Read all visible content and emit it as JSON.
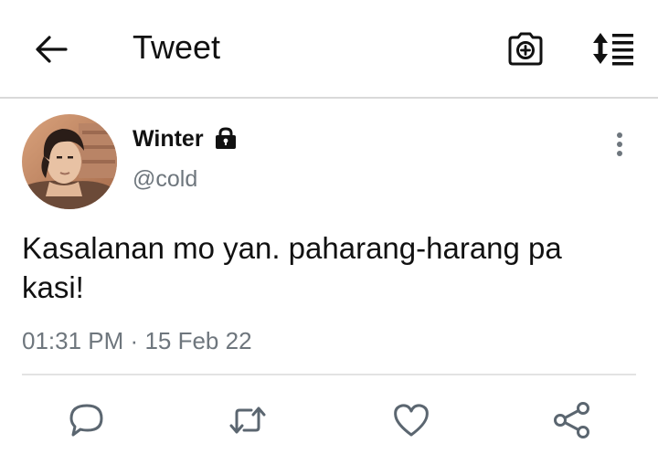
{
  "header": {
    "title": "Tweet",
    "back_icon": "arrow-left-icon",
    "camera_icon": "camera-plus-icon",
    "sort_icon": "sort-list-icon"
  },
  "tweet": {
    "author": {
      "display_name": "Winter",
      "handle": "@cold",
      "protected_icon": "lock-icon",
      "avatar": "profile-photo"
    },
    "text": "Kasalanan mo yan. paharang-harang pa kasi!",
    "time": "01:31 PM",
    "separator": "·",
    "date": "15 Feb 22",
    "more_icon": "more-vertical-icon"
  },
  "actions": {
    "reply_icon": "reply-icon",
    "retweet_icon": "retweet-icon",
    "like_icon": "heart-icon",
    "share_icon": "share-icon"
  },
  "colors": {
    "text": "#111111",
    "secondary": "#6e767d",
    "divider": "#d9d9d9"
  }
}
